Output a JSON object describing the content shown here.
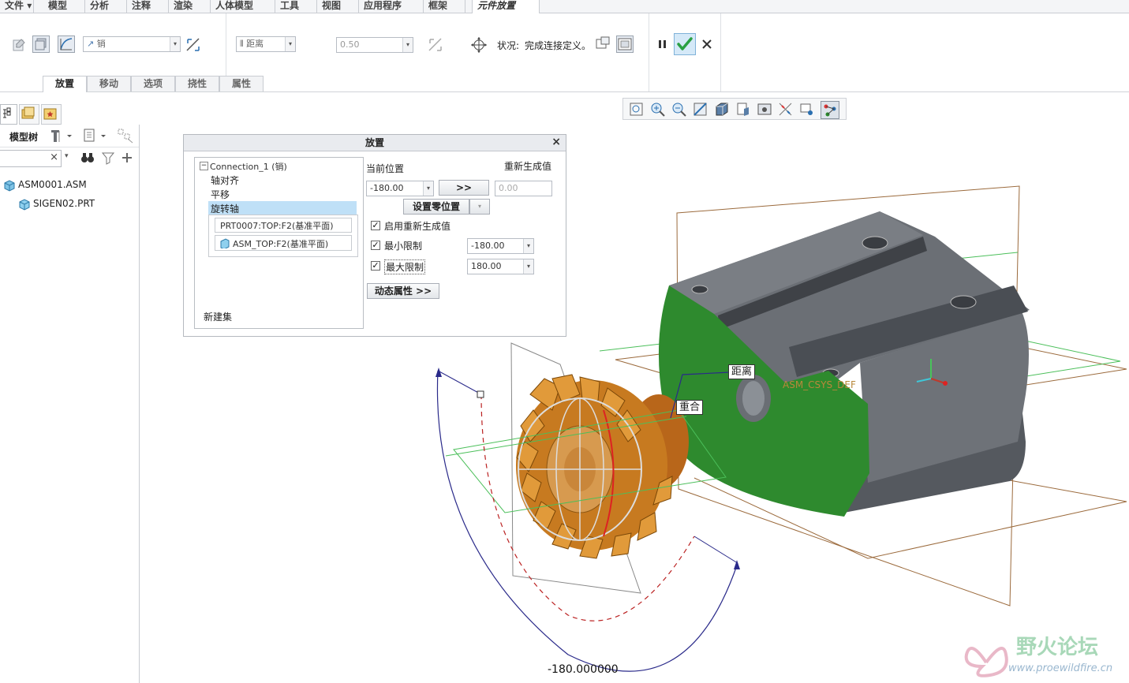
{
  "menu": {
    "tabs": [
      "文件",
      "模型",
      "分析",
      "注释",
      "渲染",
      "人体模型",
      "工具",
      "视图",
      "应用程序",
      "框架",
      "元件放置"
    ],
    "active": "元件放置"
  },
  "ribbon": {
    "connection_type": "销",
    "constraint_type": "距离",
    "offset_value": "0.50",
    "status_label": "状况:",
    "status_value": "完成连接定义。",
    "subtabs": [
      "放置",
      "移动",
      "选项",
      "挠性",
      "属性"
    ],
    "active_subtab": "放置"
  },
  "left_panel": {
    "title": "模型树",
    "search_placeholder": "",
    "tree": [
      {
        "label": "ASM0001.ASM",
        "level": 0
      },
      {
        "label": "SIGEN02.PRT",
        "level": 1
      }
    ]
  },
  "dialog": {
    "title": "放置",
    "close": "×",
    "tree": {
      "connection": "Connection_1 (销)",
      "items": [
        "轴对齐",
        "平移",
        "旋转轴"
      ],
      "selected": "旋转轴",
      "refs": [
        "PRT0007:TOP:F2(基准平面)",
        "ASM_TOP:F2(基准平面)"
      ],
      "new_set": "新建集"
    },
    "current_position_label": "当前位置",
    "regen_value_label": "重新生成值",
    "current_position": "-180.00",
    "apply_button": ">>",
    "regen_value": "0.00",
    "set_zero_button": "设置零位置",
    "enable_regen": {
      "label": "启用重新生成值",
      "checked": true
    },
    "min_limit": {
      "label": "最小限制",
      "checked": true,
      "value": "-180.00"
    },
    "max_limit": {
      "label": "最大限制",
      "checked": true,
      "value": "180.00"
    },
    "dynamic_props_button": "动态属性 >>"
  },
  "viewport": {
    "tag_distance": "距离",
    "tag_coincident": "重合",
    "csys_label": "ASM_CSYS_DEF",
    "angle_readout": "-180.000000",
    "watermark_cn": "野火论坛",
    "watermark_url": "www.proewildfire.cn"
  },
  "colors": {
    "accent_green": "#2e8a2e",
    "confirm_green": "#3cb44a",
    "gear_orange": "#c9761b",
    "block_gray": "#5c6066",
    "datum_brown": "#9b6a3c",
    "datum_green": "#4bbf5a",
    "selection_blue": "#bfe0f7"
  }
}
